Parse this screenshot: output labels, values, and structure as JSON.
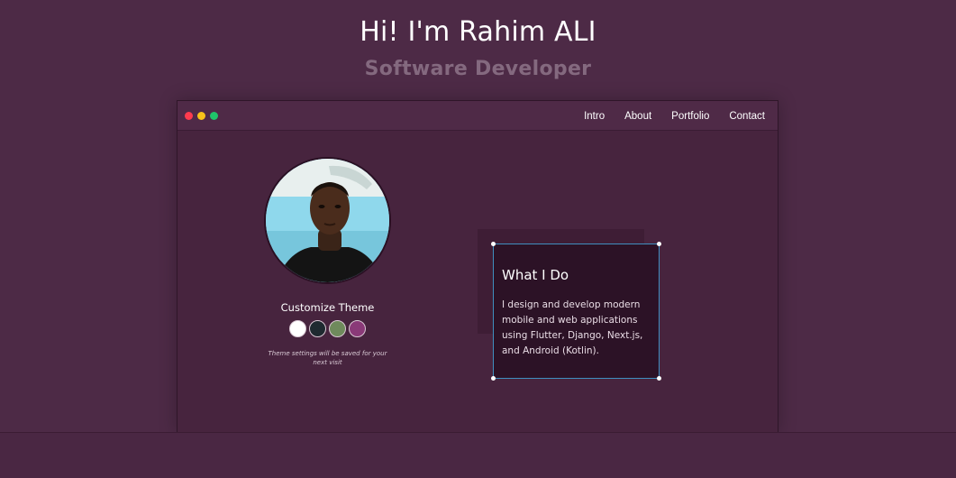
{
  "hero": {
    "title": "Hi! I'm Rahim ALI",
    "subtitle": "Software Developer"
  },
  "window": {
    "nav": {
      "items": [
        {
          "label": "Intro"
        },
        {
          "label": "About"
        },
        {
          "label": "Portfolio"
        },
        {
          "label": "Contact"
        }
      ]
    },
    "traffic_lights": [
      "#ff3b4e",
      "#f7c21a",
      "#1fc46a"
    ]
  },
  "profile": {
    "avatar_icon": "profile-photo"
  },
  "theme": {
    "title": "Customize Theme",
    "swatches": [
      "#ffffff",
      "#1f2a30",
      "#6f8a5c",
      "#8a3a78"
    ],
    "note": "Theme settings will be saved for your next visit"
  },
  "card": {
    "title": "What I Do",
    "body": "I design and develop modern mobile and web applications using Flutter, Django, Next.js, and Android (Kotlin)."
  },
  "colors": {
    "background": "#4d2a46",
    "accent_border": "#3f8fbf"
  }
}
